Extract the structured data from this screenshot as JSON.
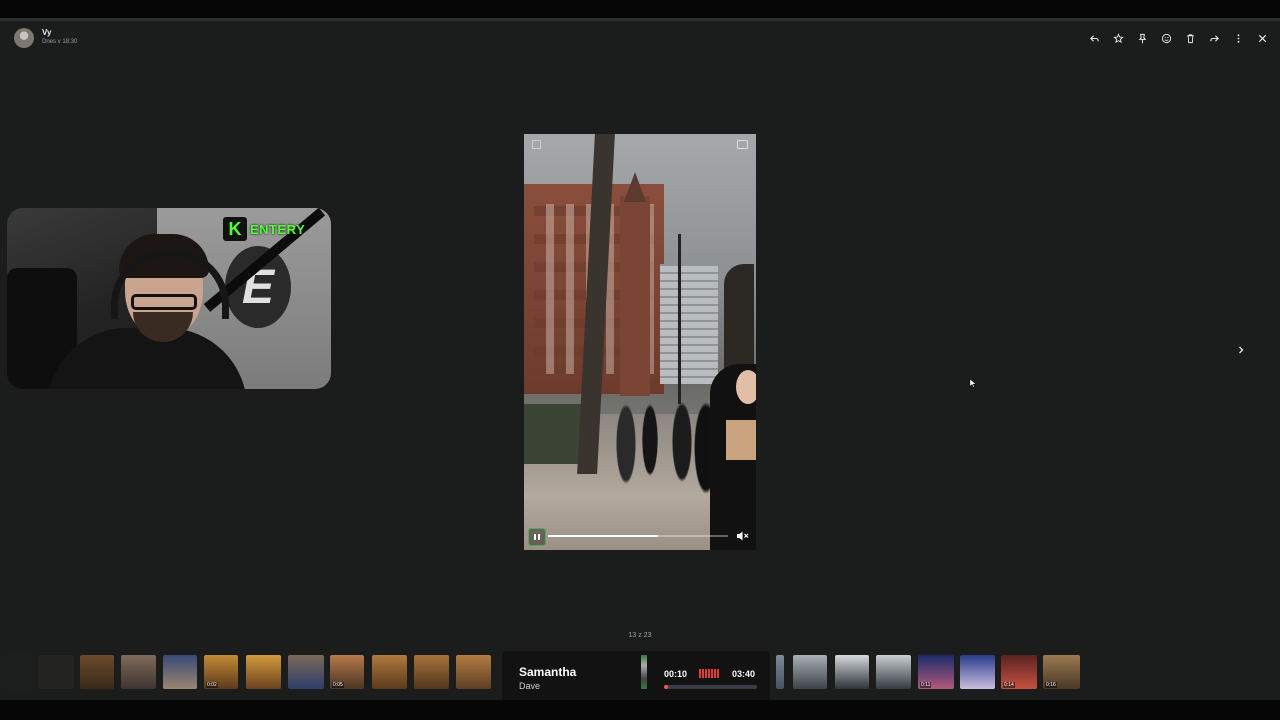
{
  "header": {
    "sender": "Vy",
    "time": "Dnes v 18:30",
    "actions": [
      "reply-icon",
      "star-icon",
      "pin-icon",
      "emoji-icon",
      "trash-icon",
      "forward-icon",
      "more-icon",
      "close-icon"
    ]
  },
  "overlay": {
    "brand_initial": "K",
    "brand_rest": "ENTERY",
    "brand_color": "#4cff2e"
  },
  "video": {
    "progress": 0.61,
    "muted": true
  },
  "viewer": {
    "counter": "13 z 23"
  },
  "thumbnails": {
    "durations": [
      "0:02",
      "0:05",
      "0:11",
      "0:14",
      "0:16"
    ]
  },
  "player": {
    "title": "Samantha",
    "artist": "Dave",
    "current": "00:10",
    "total": "03:40",
    "progress": 0.045,
    "accent": "#ef5350"
  }
}
